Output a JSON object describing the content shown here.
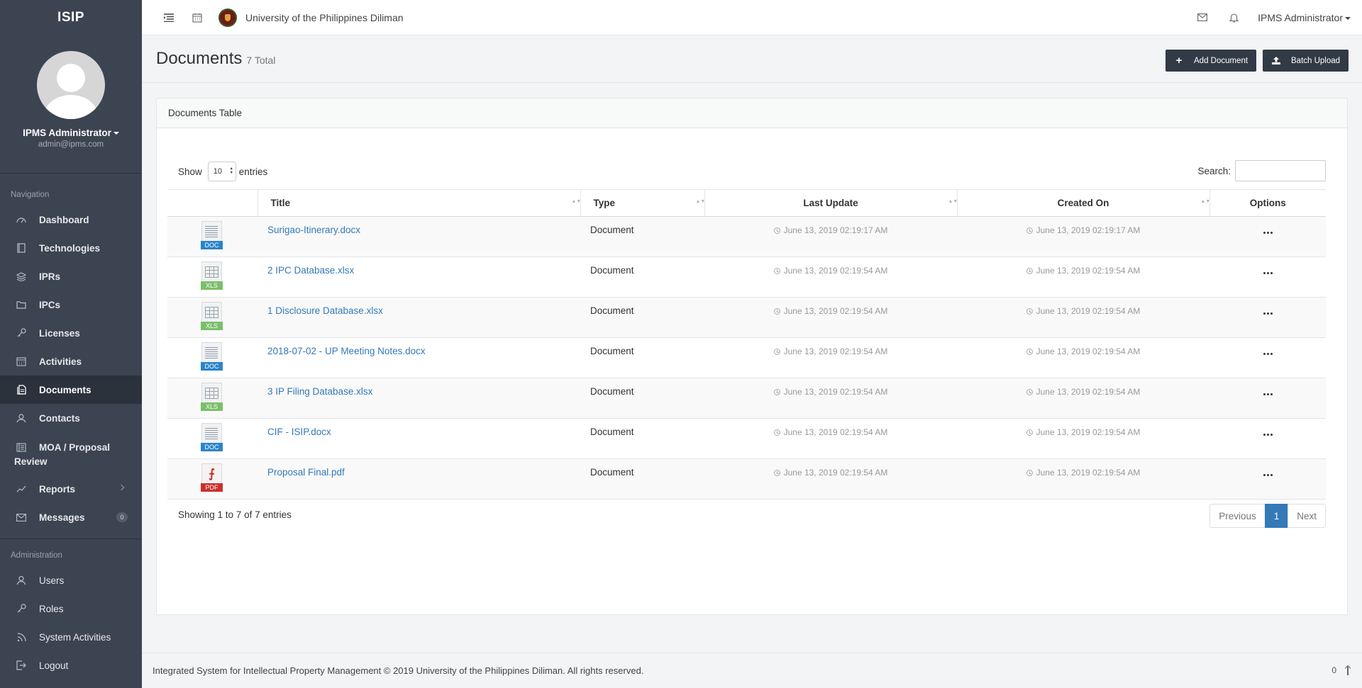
{
  "sidebar": {
    "brand": "ISIP",
    "profile": {
      "name": "IPMS Administrator",
      "email": "admin@ipms.com"
    },
    "nav_header": "Navigation",
    "items": [
      {
        "label": "Dashboard",
        "icon": "dashboard-icon"
      },
      {
        "label": "Technologies",
        "icon": "book-icon"
      },
      {
        "label": "IPRs",
        "icon": "layers-icon"
      },
      {
        "label": "IPCs",
        "icon": "folder-icon"
      },
      {
        "label": "Licenses",
        "icon": "key-icon"
      },
      {
        "label": "Activities",
        "icon": "calendar-icon"
      },
      {
        "label": "Documents",
        "icon": "documents-icon",
        "active": true
      },
      {
        "label": "Contacts",
        "icon": "contacts-icon"
      },
      {
        "label": "MOA / Proposal Review",
        "icon": "book-open-icon"
      },
      {
        "label": "Reports",
        "icon": "trend-icon"
      },
      {
        "label": "Messages",
        "icon": "envelope-icon",
        "badge": "0"
      }
    ],
    "admin_header": "Administration",
    "admin_items": [
      {
        "label": "Users",
        "icon": "user-icon"
      },
      {
        "label": "Roles",
        "icon": "key-icon"
      },
      {
        "label": "System Activities",
        "icon": "rss-icon"
      },
      {
        "label": "Logout",
        "icon": "logout-icon"
      }
    ]
  },
  "topbar": {
    "university": "University of the Philippines Diliman",
    "user": "IPMS Administrator"
  },
  "header": {
    "title": "Documents",
    "count": "7 Total",
    "add_label": "Add Document",
    "batch_label": "Batch Upload"
  },
  "panel": {
    "heading": "Documents Table",
    "show_label": "Show",
    "entries_value": "10",
    "entries_label": "entries",
    "search_label": "Search:",
    "columns": [
      "Title",
      "Type",
      "Last Update",
      "Created On",
      "Options"
    ],
    "rows": [
      {
        "icon": "doc",
        "title": "Surigao-Itinerary.docx",
        "type": "Document",
        "updated": "June 13, 2019 02:19:17 AM",
        "created": "June 13, 2019 02:19:17 AM"
      },
      {
        "icon": "xls",
        "title": "2 IPC Database.xlsx",
        "type": "Document",
        "updated": "June 13, 2019 02:19:54 AM",
        "created": "June 13, 2019 02:19:54 AM"
      },
      {
        "icon": "xls",
        "title": "1 Disclosure Database.xlsx",
        "type": "Document",
        "updated": "June 13, 2019 02:19:54 AM",
        "created": "June 13, 2019 02:19:54 AM"
      },
      {
        "icon": "doc",
        "title": "2018-07-02 - UP Meeting Notes.docx",
        "type": "Document",
        "updated": "June 13, 2019 02:19:54 AM",
        "created": "June 13, 2019 02:19:54 AM"
      },
      {
        "icon": "xls",
        "title": "3 IP Filing Database.xlsx",
        "type": "Document",
        "updated": "June 13, 2019 02:19:54 AM",
        "created": "June 13, 2019 02:19:54 AM"
      },
      {
        "icon": "doc",
        "title": "CIF - ISIP.docx",
        "type": "Document",
        "updated": "June 13, 2019 02:19:54 AM",
        "created": "June 13, 2019 02:19:54 AM"
      },
      {
        "icon": "pdf",
        "title": "Proposal Final.pdf",
        "type": "Document",
        "updated": "June 13, 2019 02:19:54 AM",
        "created": "June 13, 2019 02:19:54 AM"
      }
    ],
    "info": "Showing 1 to 7 of 7 entries",
    "pager": {
      "prev": "Previous",
      "page": "1",
      "next": "Next"
    }
  },
  "footer": {
    "text": "Integrated System for Intellectual Property Management © 2019 University of the Philippines Diliman. All rights reserved.",
    "counter": "0"
  },
  "colors": {
    "sidebar": "#3d4451",
    "sidebar_active": "#2c323c",
    "button_dark": "#323a45",
    "link": "#337ab7"
  },
  "file_tags": {
    "doc": "DOC",
    "xls": "XLS",
    "pdf": "PDF"
  }
}
